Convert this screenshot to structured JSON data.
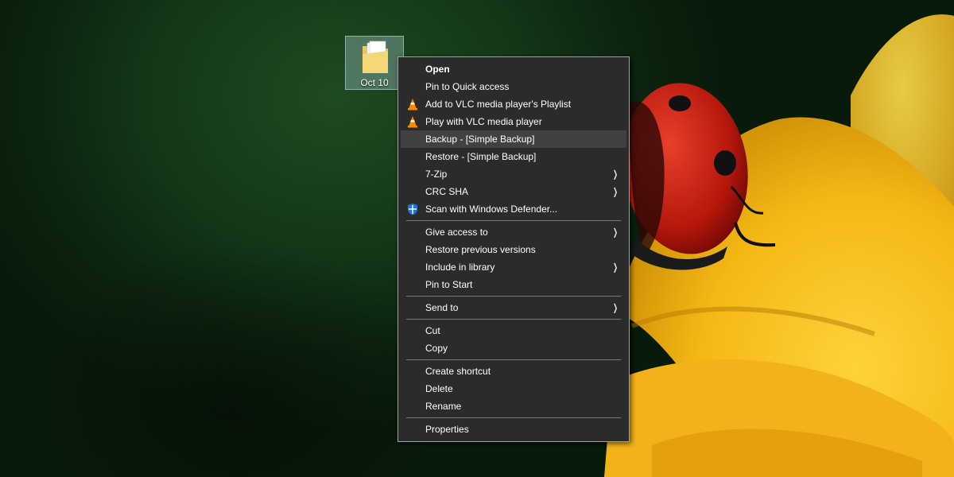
{
  "desktop": {
    "icon_label": "Oct 10"
  },
  "context_menu": {
    "items": [
      {
        "label": "Open",
        "icon": "none",
        "bold": true
      },
      {
        "label": "Pin to Quick access",
        "icon": "none"
      },
      {
        "label": "Add to VLC media player's Playlist",
        "icon": "vlc-icon"
      },
      {
        "label": "Play with VLC media player",
        "icon": "vlc-icon"
      },
      {
        "label": "Backup - [Simple Backup]",
        "icon": "none",
        "highlighted": true
      },
      {
        "label": "Restore - [Simple Backup]",
        "icon": "none"
      },
      {
        "label": "7-Zip",
        "icon": "none",
        "submenu": true
      },
      {
        "label": "CRC SHA",
        "icon": "none",
        "submenu": true
      },
      {
        "label": "Scan with Windows Defender...",
        "icon": "windows-defender-icon"
      },
      {
        "label": "Give access to",
        "icon": "none",
        "submenu": true
      },
      {
        "label": "Restore previous versions",
        "icon": "none"
      },
      {
        "label": "Include in library",
        "icon": "none",
        "submenu": true
      },
      {
        "label": "Pin to Start",
        "icon": "none"
      },
      {
        "label": "Send to",
        "icon": "none",
        "submenu": true
      },
      {
        "label": "Cut",
        "icon": "none"
      },
      {
        "label": "Copy",
        "icon": "none"
      },
      {
        "label": "Create shortcut",
        "icon": "none"
      },
      {
        "label": "Delete",
        "icon": "none"
      },
      {
        "label": "Rename",
        "icon": "none"
      },
      {
        "label": "Properties",
        "icon": "none"
      }
    ],
    "submenu_arrow": "❯"
  },
  "colors": {
    "menu_bg": "#2b2b2b",
    "menu_highlight": "#414141",
    "separator": "#7a7a7a",
    "vlc_orange": "#ff8800",
    "defender_blue": "#1e73d8"
  }
}
